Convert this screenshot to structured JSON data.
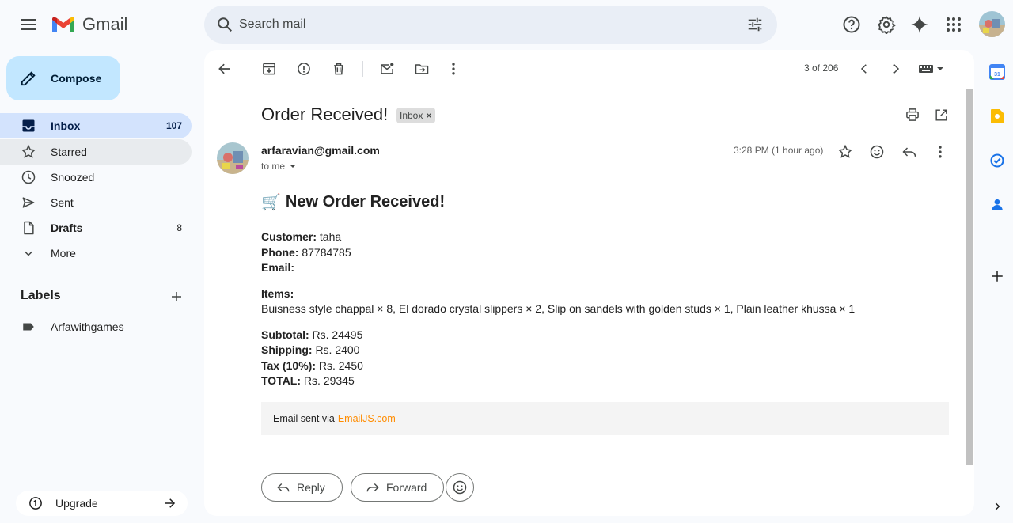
{
  "header": {
    "app_name": "Gmail",
    "search_placeholder": "Search mail"
  },
  "sidebar": {
    "compose_label": "Compose",
    "items": [
      {
        "label": "Inbox",
        "count": "107",
        "icon": "inbox-icon"
      },
      {
        "label": "Starred",
        "count": "",
        "icon": "star-icon"
      },
      {
        "label": "Snoozed",
        "count": "",
        "icon": "clock-icon"
      },
      {
        "label": "Sent",
        "count": "",
        "icon": "send-icon"
      },
      {
        "label": "Drafts",
        "count": "8",
        "icon": "draft-icon"
      },
      {
        "label": "More",
        "count": "",
        "icon": "chevron-down-icon"
      }
    ],
    "labels_title": "Labels",
    "labels": [
      {
        "label": "Arfawithgames",
        "icon": "label-icon"
      }
    ],
    "upgrade_label": "Upgrade"
  },
  "toolbar": {
    "counter": "3 of 206"
  },
  "message": {
    "subject": "Order Received!",
    "chip": "Inbox",
    "sender": "arfaravian@gmail.com",
    "to": "to me",
    "time": "3:28 PM (1 hour ago)",
    "heading_emoji": "🛒",
    "heading": "New Order Received!",
    "customer_label": "Customer:",
    "customer": "taha",
    "phone_label": "Phone:",
    "phone": "87784785",
    "email_label": "Email:",
    "email": "",
    "items_label": "Items:",
    "items": "Buisness style chappal × 8, El dorado crystal slippers × 2, Slip on sandels with golden studs × 1, Plain leather khussa × 1",
    "subtotal_label": "Subtotal:",
    "subtotal": "Rs. 24495",
    "shipping_label": "Shipping:",
    "shipping": "Rs. 2400",
    "tax_label": "Tax (10%):",
    "tax": "Rs. 2450",
    "total_label": "TOTAL:",
    "total": "Rs. 29345",
    "footer_text": "Email sent via",
    "footer_link": "EmailJS.com"
  },
  "actions": {
    "reply": "Reply",
    "forward": "Forward"
  },
  "colors": {
    "accent": "#c2e7ff",
    "active_nav": "#d3e3fd",
    "link_orange": "#ff8c00"
  }
}
